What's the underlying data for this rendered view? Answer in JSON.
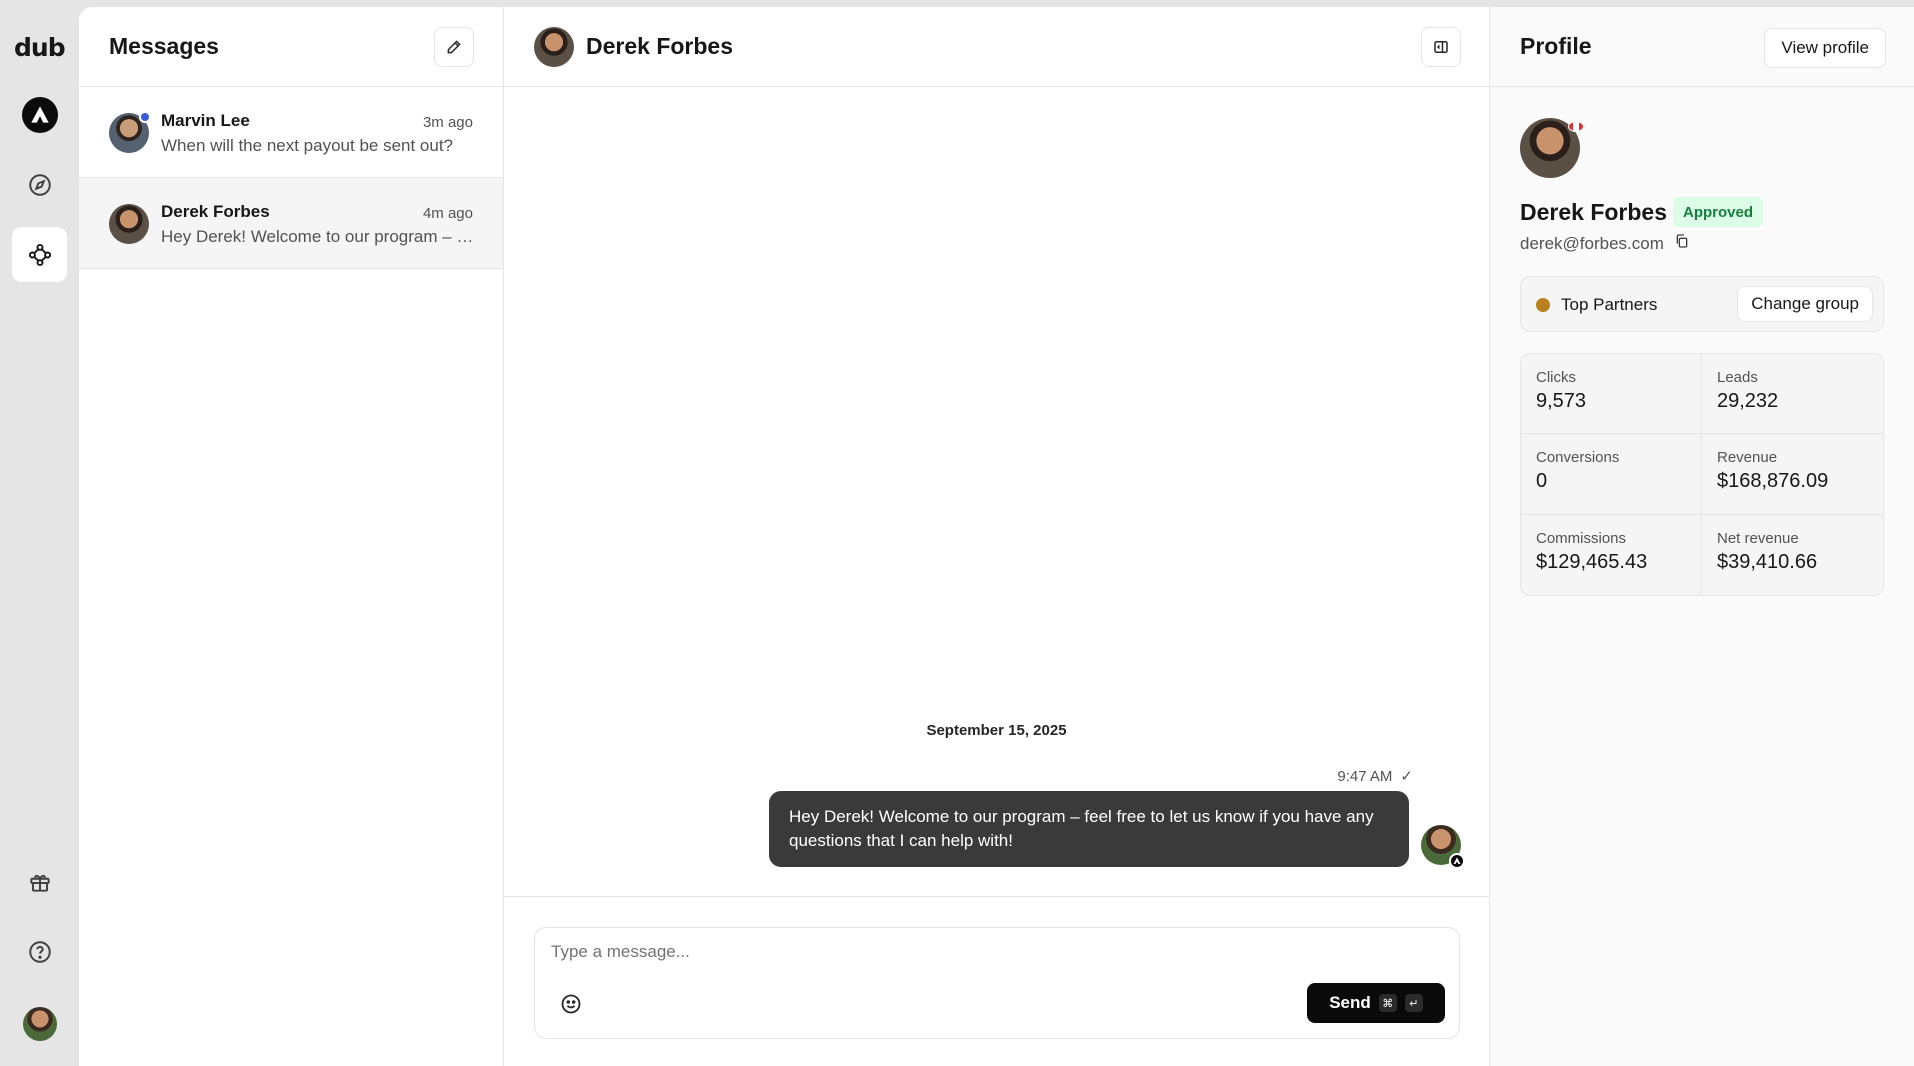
{
  "app": {
    "logo": "dub"
  },
  "sidebar": {
    "items": [
      {
        "icon": "workspace-avatar-icon"
      },
      {
        "icon": "compass-icon"
      },
      {
        "icon": "network-icon",
        "active": true
      },
      {
        "icon": "gift-icon"
      },
      {
        "icon": "help-icon"
      },
      {
        "icon": "user-avatar"
      }
    ]
  },
  "messages_panel": {
    "title": "Messages",
    "threads": [
      {
        "name": "Marvin Lee",
        "time": "3m ago",
        "preview": "When will the next payout be sent out?",
        "unread": true
      },
      {
        "name": "Derek Forbes",
        "time": "4m ago",
        "preview": "Hey Derek! Welcome to our program – feel free to let us know if you have any questions",
        "selected": true
      }
    ]
  },
  "chat": {
    "partner_name": "Derek Forbes",
    "date_separator": "September 15, 2025",
    "message": {
      "time": "9:47 AM",
      "status": "✓",
      "text": "Hey Derek! Welcome to our program – feel free to let us know if you have any questions that I can help with!"
    },
    "composer": {
      "placeholder": "Type a message...",
      "send_label": "Send",
      "kbd_cmd": "⌘",
      "kbd_enter": "↵"
    }
  },
  "profile": {
    "title": "Profile",
    "view_profile_label": "View profile",
    "name": "Derek Forbes",
    "status_badge": "Approved",
    "email": "derek@forbes.com",
    "group": {
      "name": "Top Partners",
      "color": "#b7821e",
      "change_label": "Change group"
    },
    "stats": [
      {
        "label": "Clicks",
        "value": "9,573"
      },
      {
        "label": "Leads",
        "value": "29,232"
      },
      {
        "label": "Conversions",
        "value": "0"
      },
      {
        "label": "Revenue",
        "value": "$168,876.09"
      },
      {
        "label": "Commissions",
        "value": "$129,465.43"
      },
      {
        "label": "Net revenue",
        "value": "$39,410.66"
      }
    ]
  },
  "colors": {
    "accent_online": "#3b5bdb",
    "bubble": "#3a3a3a",
    "approved_bg": "#dcfce7",
    "approved_text": "#15803d"
  }
}
